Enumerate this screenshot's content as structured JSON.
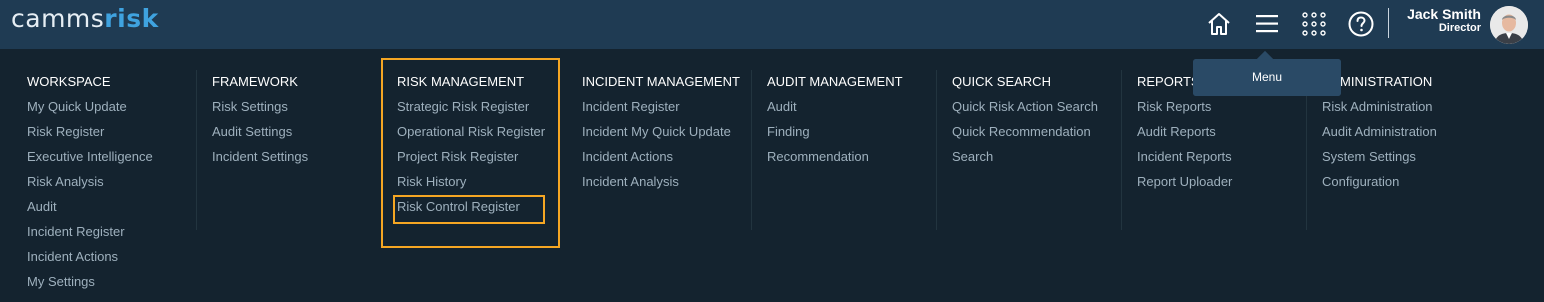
{
  "header": {
    "logo_part1": "camms",
    "logo_part2": "risk",
    "user_name": "Jack Smith",
    "user_role": "Director",
    "menu_tooltip": "Menu"
  },
  "icons": [
    "home-icon",
    "hamburger-icon",
    "apps-grid-icon",
    "help-icon",
    "avatar"
  ],
  "colors": {
    "topbar": "#1f3b53",
    "panel": "#14232f",
    "accent": "#3fa3e0",
    "highlight": "#f5a623",
    "muted_text": "#9eb0bd"
  },
  "menu": {
    "columns": [
      {
        "title": "WORKSPACE",
        "items": [
          "My Quick Update",
          "Risk Register",
          "Executive Intelligence",
          "Risk Analysis",
          "Audit",
          "Incident Register",
          "Incident Actions",
          "My Settings"
        ]
      },
      {
        "title": "FRAMEWORK",
        "items": [
          "Risk Settings",
          "Audit Settings",
          "Incident Settings"
        ]
      },
      {
        "title": "RISK MANAGEMENT",
        "items": [
          "Strategic Risk Register",
          "Operational Risk Register",
          "Project Risk Register",
          "Risk History",
          "Risk Control Register"
        ]
      },
      {
        "title": "INCIDENT MANAGEMENT",
        "items": [
          "Incident Register",
          "Incident My Quick Update",
          "Incident Actions",
          "Incident Analysis"
        ]
      },
      {
        "title": "AUDIT MANAGEMENT",
        "items": [
          "Audit",
          "Finding",
          "Recommendation"
        ]
      },
      {
        "title": "QUICK SEARCH",
        "items": [
          "Quick Risk Action Search",
          "Quick Recommendation",
          "Search"
        ]
      },
      {
        "title": "REPORTS",
        "items": [
          "Risk Reports",
          "Audit Reports",
          "Incident Reports",
          "Report Uploader"
        ]
      },
      {
        "title": "ADMINISTRATION",
        "items": [
          "Risk Administration",
          "Audit Administration",
          "System Settings",
          "Configuration"
        ]
      }
    ]
  }
}
